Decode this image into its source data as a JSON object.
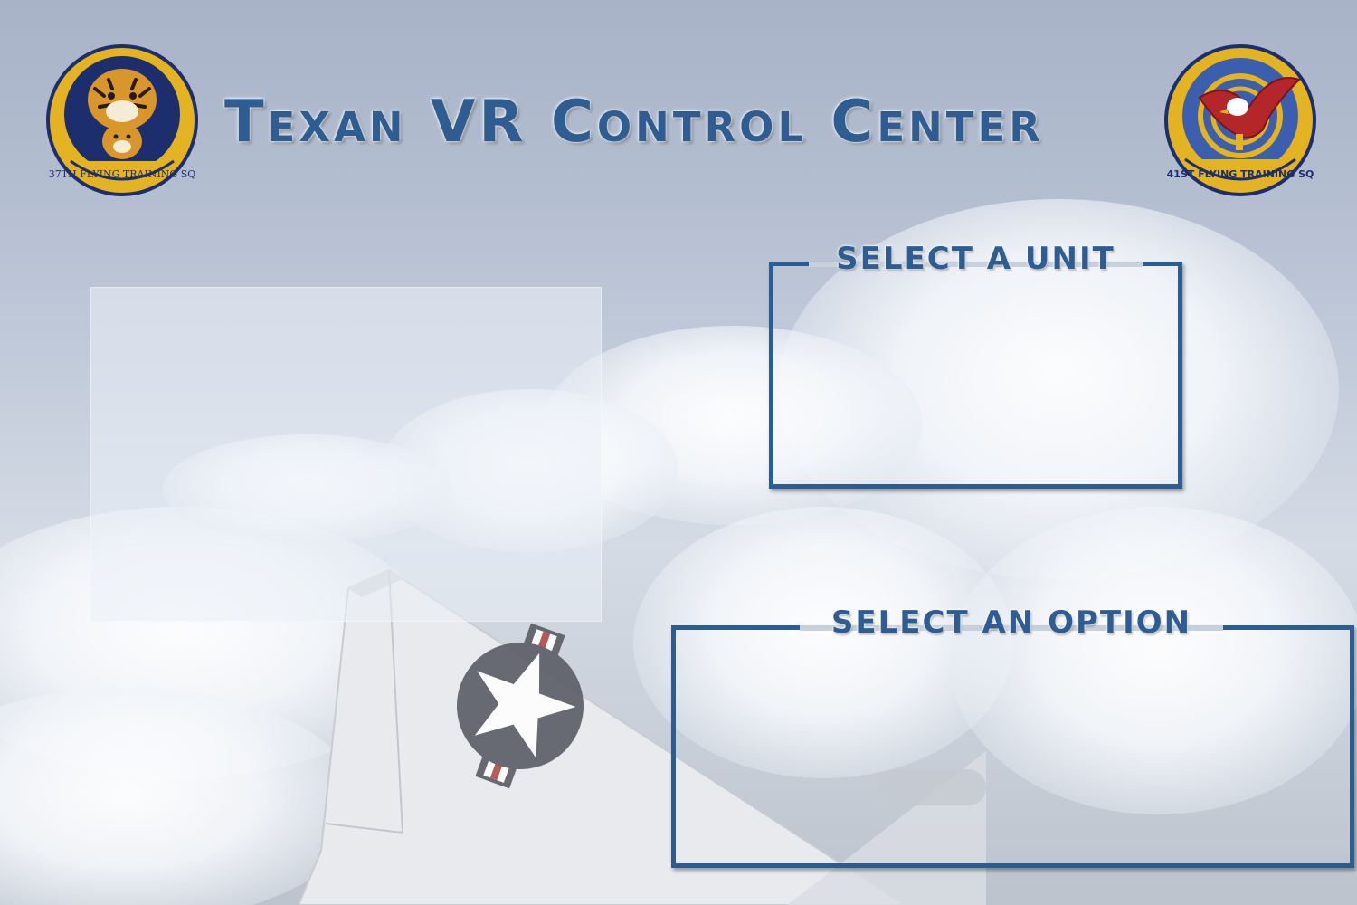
{
  "header": {
    "title": "Texan VR Control Center"
  },
  "logos": {
    "left": {
      "icon": "37th-flying-training-sq-tiger-patch-icon",
      "text": "37TH FLYING TRAINING SQ"
    },
    "right": {
      "icon": "41st-flying-training-sq-eagle-patch-icon",
      "text": "41ST FLYING TRAINING SQ"
    }
  },
  "unit_selector": {
    "label": "SELECT A UNIT"
  },
  "option_selector": {
    "label": "SELECT AN OPTION"
  },
  "colors": {
    "accent": "#2d5c91",
    "title_text": "#2f5d92",
    "patch_gold": "#e3b321",
    "patch_navy": "#1c2e6e"
  }
}
